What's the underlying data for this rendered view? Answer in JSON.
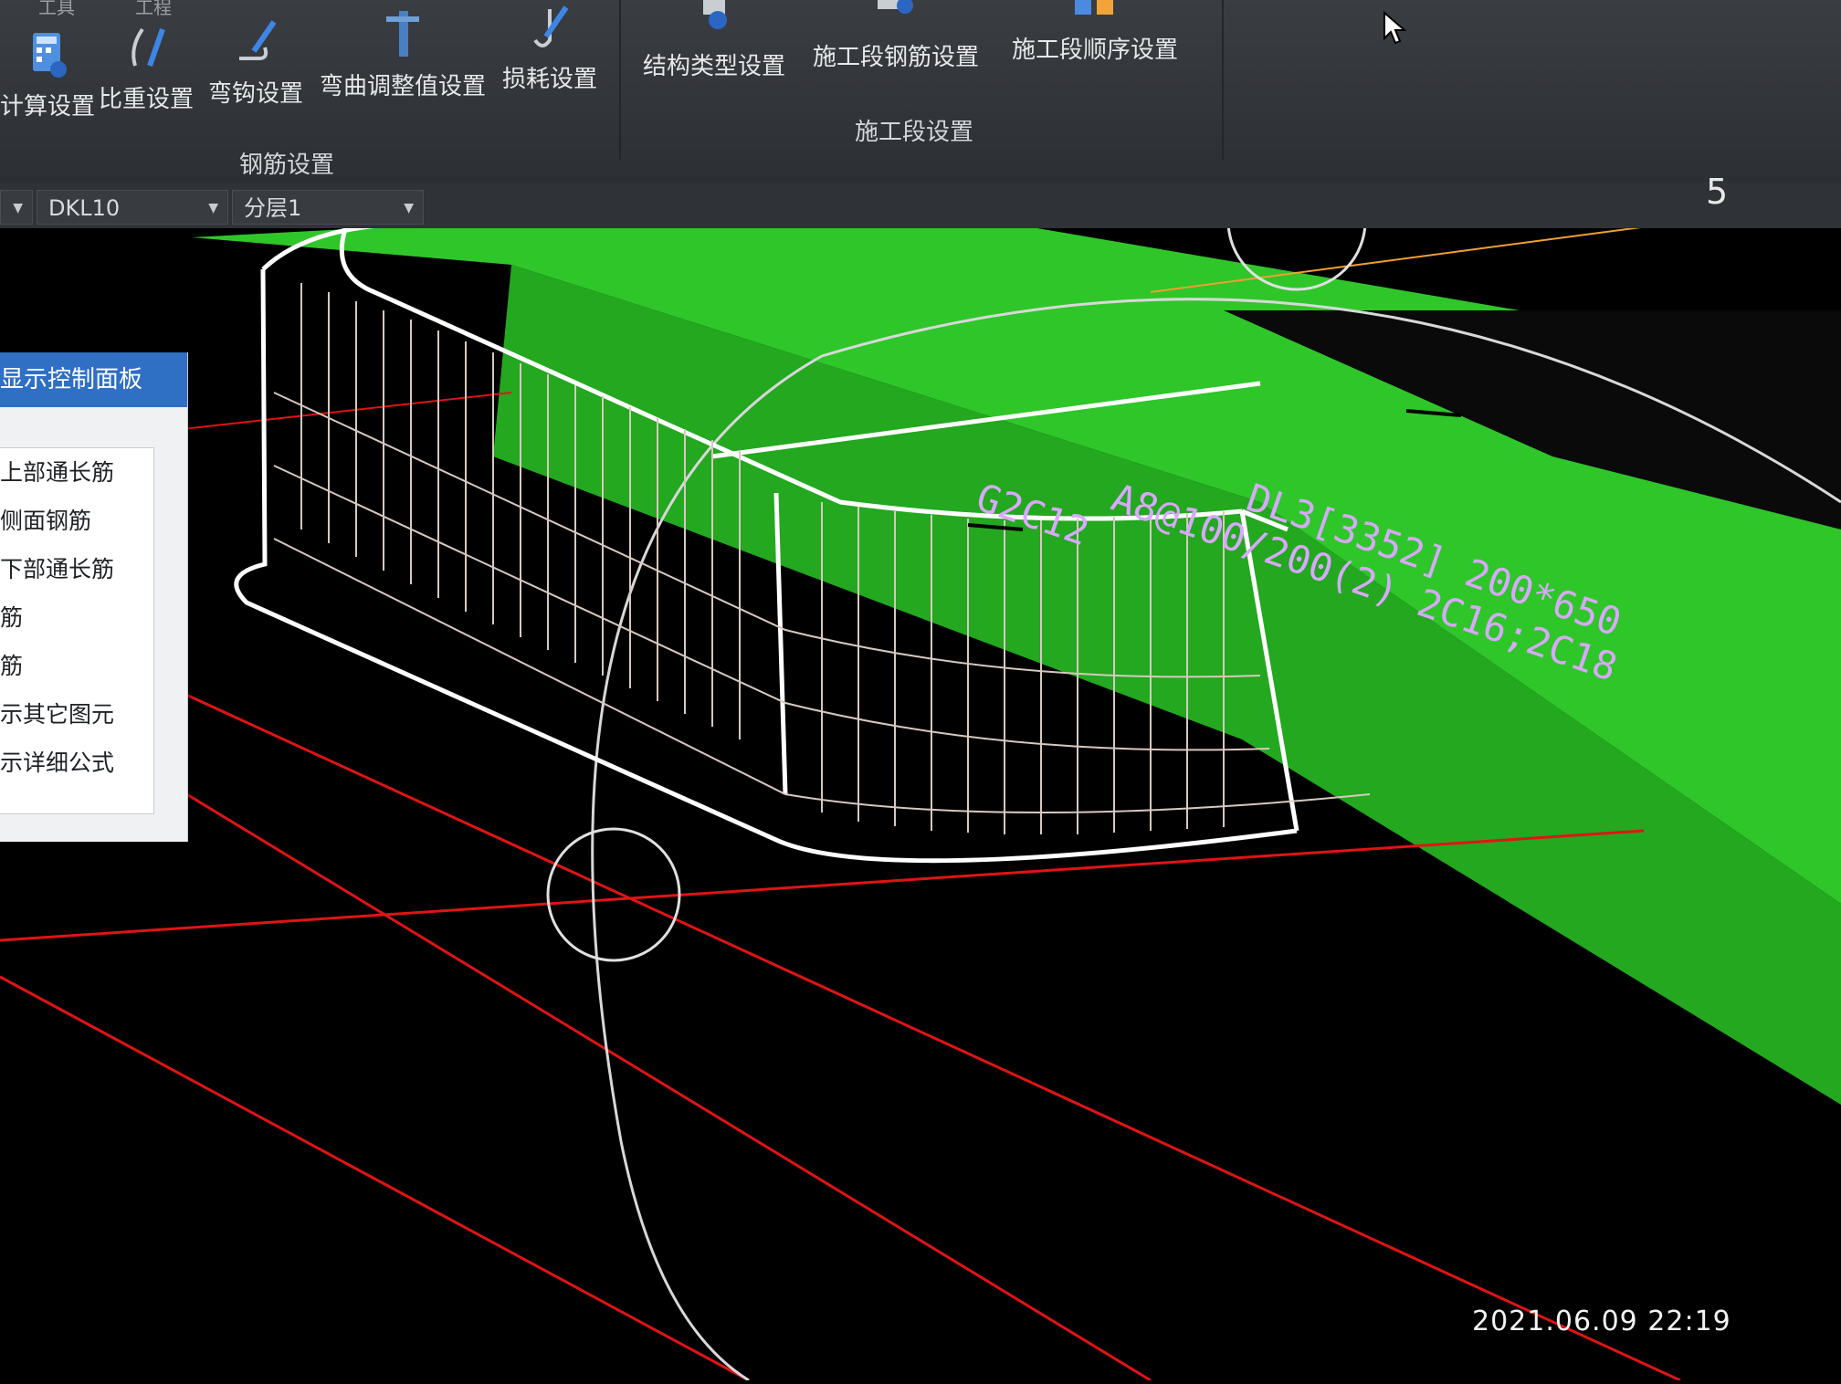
{
  "ribbon": {
    "tabs": [
      "工具",
      "工程"
    ],
    "groups": [
      {
        "label": "钢筋设置",
        "buttons": [
          "计算设置",
          "比重设置",
          "弯钩设置",
          "弯曲调整值设置",
          "损耗设置"
        ]
      },
      {
        "label": "施工段设置",
        "buttons": [
          "结构类型设置",
          "施工段钢筋设置",
          "施工段顺序设置"
        ]
      }
    ]
  },
  "toolbar": {
    "element_select": "DKL10",
    "layer_select": "分层1",
    "view_number": "5"
  },
  "panel": {
    "title": "显示控制面板",
    "items": [
      "上部通长筋",
      "侧面钢筋",
      "下部通长筋",
      "筋",
      "筋",
      "示其它图元",
      "示详细公式"
    ]
  },
  "annotations": {
    "line1": "DL3[3352] 200*650",
    "line2": "A8@100/200(2) 2C16;2C18",
    "line3": "G2C12"
  },
  "timestamp": "2021.06.09 22:19",
  "colors": {
    "ribbon_bg": "#2c2f33",
    "slab_green": "#2fc62a",
    "grid_red": "#e01414",
    "panel_header": "#2f6fc4",
    "annotation_text": "#d9a8ff"
  }
}
